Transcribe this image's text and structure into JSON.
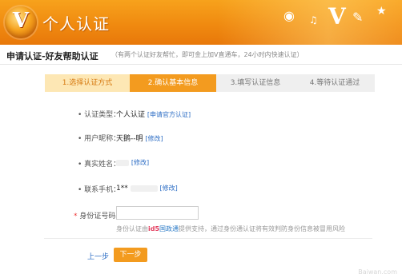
{
  "header": {
    "logo_letter": "V",
    "title": "个人认证"
  },
  "subheader": {
    "title": "申请认证-好友帮助认证",
    "note": "（有两个认证好友帮忙，即可金上加V直通车，24小时内快速认证）"
  },
  "steps": [
    {
      "label": "1.选择认证方式"
    },
    {
      "label": "2.确认基本信息"
    },
    {
      "label": "3.填写认证信息"
    },
    {
      "label": "4.等待认证通过"
    }
  ],
  "form": {
    "type_label": "认证类型：",
    "type_value": "个人认证",
    "type_link": "[申请官方认证]",
    "nickname_label": "用户昵称：",
    "nickname_value": "天鹅--明",
    "nickname_link": "[修改]",
    "realname_label": "真实姓名：",
    "realname_link": "[修改]",
    "phone_label": "联系手机：",
    "phone_value": "1**",
    "phone_link": "[修改]",
    "id_required": "*",
    "id_label": "身份证号码：",
    "id_value": "",
    "hint_pre": "身份认证由",
    "hint_ids": "id5",
    "hint_gz": "国政通",
    "hint_post": "提供支持，通过身份通认证将有效判防身份信息被冒用风险"
  },
  "actions": {
    "prev": "上一步",
    "next": "下一步"
  },
  "watermark": "Baiwan.com"
}
